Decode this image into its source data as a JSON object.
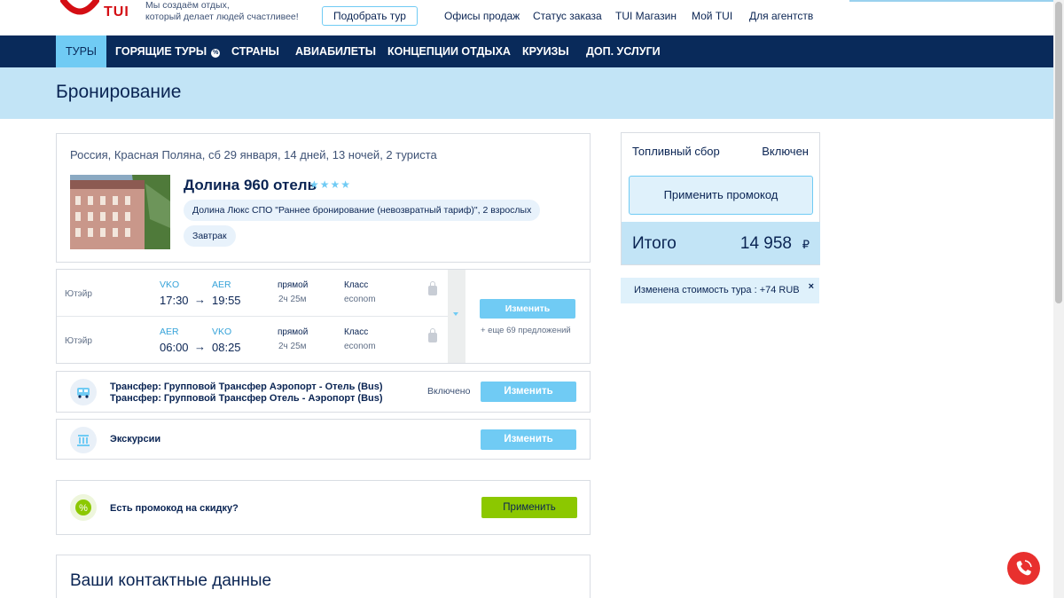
{
  "header": {
    "logo_text": "TUI",
    "tagline_line1": "Мы создаём отдых,",
    "tagline_line2": "который делает людей счастливее!",
    "pick_tour_button": "Подобрать тур",
    "links": [
      "Офисы продаж",
      "Статус заказа",
      "TUI Магазин",
      "Мой TUI",
      "Для агентств"
    ]
  },
  "nav": {
    "items": [
      "ТУРЫ",
      "ГОРЯЩИЕ ТУРЫ",
      "СТРАНЫ",
      "АВИАБИЛЕТЫ",
      "КОНЦЕПЦИИ ОТДЫХА",
      "КРУИЗЫ",
      "ДОП. УСЛУГИ"
    ],
    "hot_badge": "%"
  },
  "page": {
    "title": "Бронирование"
  },
  "tour": {
    "route": "Россия, Красная Поляна, сб 29 января, 14 дней, 13 ночей, 2 туриста",
    "hotel_name": "Долина 960 отель",
    "stars": 4,
    "room": "Долина Люкс СПО \"Раннее бронирование (невозвратный тариф)\", 2 взрослых",
    "meal": "Завтрак"
  },
  "flights": [
    {
      "airline": "Ютэйр",
      "from": "VKO",
      "to": "AER",
      "dep": "17:30",
      "arr": "19:55",
      "type": "прямой",
      "duration": "2ч 25м",
      "class_label": "Класс",
      "class": "econom"
    },
    {
      "airline": "Ютэйр",
      "from": "AER",
      "to": "VKO",
      "dep": "06:00",
      "arr": "08:25",
      "type": "прямой",
      "duration": "2ч 25м",
      "class_label": "Класс",
      "class": "econom"
    }
  ],
  "flight_panel": {
    "arrow": "→",
    "change_button": "Изменить",
    "more_offers": "+ еще 69 предложений"
  },
  "transfer": {
    "line1": "Трансфер: Групповой Трансфер Аэропорт - Отель (Bus)",
    "line2": "Трансфер: Групповой Трансфер Отель - Аэропорт (Bus)",
    "status": "Включено",
    "change_button": "Изменить"
  },
  "excursions": {
    "label": "Экскурсии",
    "change_button": "Изменить"
  },
  "promo": {
    "label": "Есть промокод на скидку?",
    "apply_button": "Применить",
    "icon_glyph": "%"
  },
  "contacts": {
    "title": "Ваши контактные данные"
  },
  "sidebar": {
    "fuel_label": "Топливный сбор",
    "fuel_value": "Включен",
    "promo_button": "Применить промокод",
    "total_label": "Итого",
    "total_value": "14 958",
    "currency": "₽"
  },
  "notice": {
    "text": "Изменена стоимость тура : +74 RUB",
    "close": "×"
  },
  "colors": {
    "navy": "#092a5a",
    "accent": "#70cbf4",
    "brand_red": "#d40e14",
    "green": "#8cc800"
  }
}
